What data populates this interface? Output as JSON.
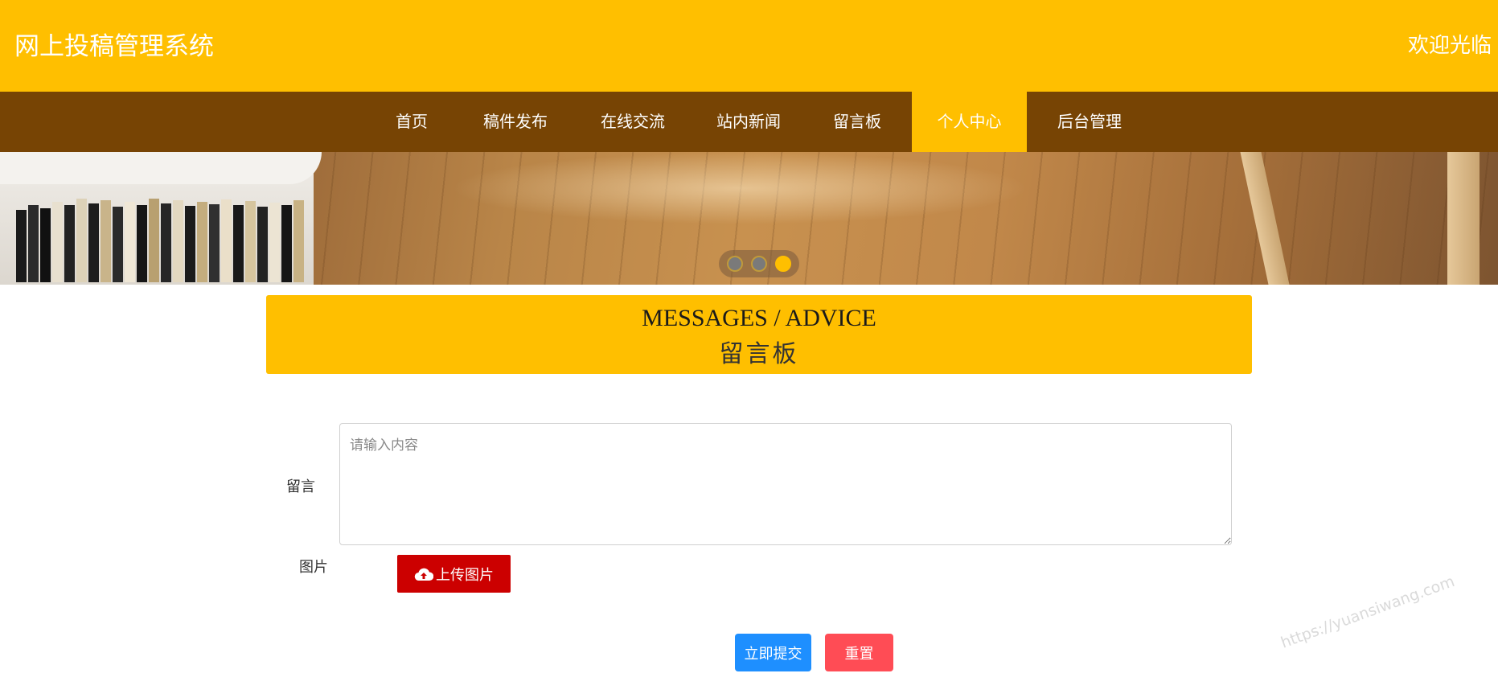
{
  "header": {
    "site_title": "网上投稿管理系统",
    "welcome_text": "欢迎光临"
  },
  "nav": {
    "items": [
      {
        "label": "首页",
        "active": false
      },
      {
        "label": "稿件发布",
        "active": false
      },
      {
        "label": "在线交流",
        "active": false
      },
      {
        "label": "站内新闻",
        "active": false
      },
      {
        "label": "留言板",
        "active": false
      },
      {
        "label": "个人中心",
        "active": true
      },
      {
        "label": "后台管理",
        "active": false
      }
    ]
  },
  "banner": {
    "slide_count": 3,
    "active_slide": 3
  },
  "section": {
    "title_en": "MESSAGES / ADVICE",
    "title_cn": "留言板"
  },
  "form": {
    "message_label": "留言",
    "message_value": "",
    "message_placeholder": "请输入内容",
    "image_label": "图片",
    "upload_button": "上传图片",
    "submit_button": "立即提交",
    "reset_button": "重置"
  },
  "watermark": "https://yuansiwang.com",
  "colors": {
    "brand_yellow": "#ffbf00",
    "nav_brown": "#774404",
    "upload_red": "#cc0000",
    "submit_blue": "#1e8fff",
    "reset_red": "#ff4c55"
  },
  "icons": {
    "upload": "cloud-upload-icon"
  }
}
